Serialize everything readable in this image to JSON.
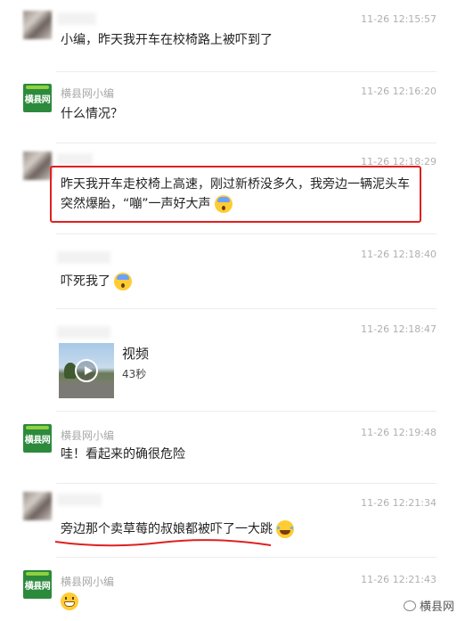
{
  "messages": [
    {
      "id": "m1",
      "sender": "",
      "time": "11-26 12:15:57",
      "text": "小编，昨天我开车在校椅路上被吓到了"
    },
    {
      "id": "m2",
      "sender": "横县网小编",
      "time": "11-26 12:16:20",
      "text": "什么情况？"
    },
    {
      "id": "m3",
      "sender": "",
      "time": "11-26 12:18:29",
      "line1": "昨天我开车走校椅上高速，刚过新桥没多久，我旁边一辆泥头车",
      "line2": "突然爆胎，“嘣”一声好大声",
      "emoji": "scream-emoji"
    },
    {
      "id": "m4",
      "sender": "",
      "time": "11-26 12:18:40",
      "text": "吓死我了",
      "emoji": "scream-emoji"
    },
    {
      "id": "m5",
      "sender": "",
      "time": "11-26 12:18:47",
      "video_title": "视频",
      "video_duration": "43秒"
    },
    {
      "id": "m6",
      "sender": "横县网小编",
      "time": "11-26 12:19:48",
      "text": "哇！看起来的确很危险"
    },
    {
      "id": "m7",
      "sender": "",
      "time": "11-26 12:21:34",
      "text": "旁边那个卖草莓的叔娘都被吓了一大跳",
      "emoji": "laugh-emoji"
    },
    {
      "id": "m8",
      "sender": "横县网小编",
      "time": "11-26 12:21:43",
      "emoji": "grin-emoji"
    }
  ],
  "logo_text": "横县网",
  "watermark": "横县网",
  "colors": {
    "highlight": "#e02020",
    "logo_bg": "#2c8a3d",
    "time": "#b0b0b0"
  }
}
